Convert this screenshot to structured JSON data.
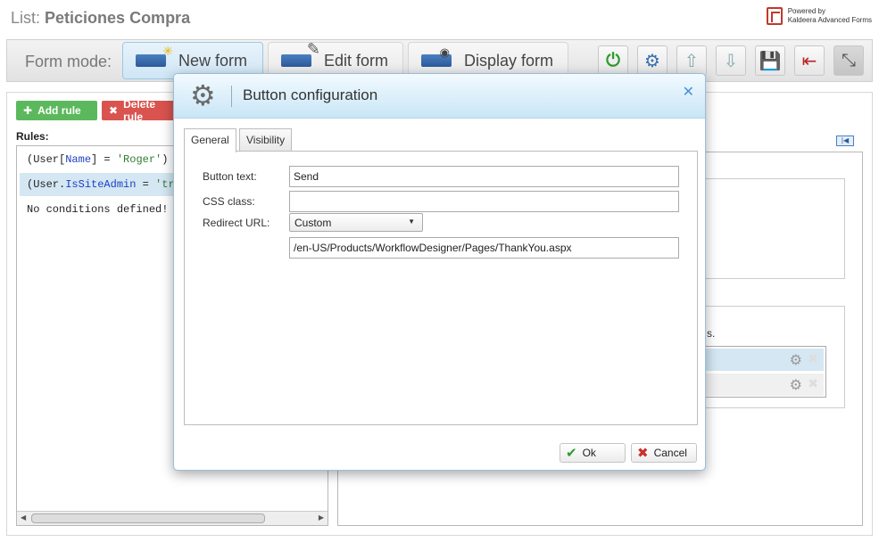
{
  "header": {
    "list_prefix": "List:",
    "list_name": "Peticiones Compra",
    "powered_line1": "Powered by",
    "powered_line2": "Kaldeera Advanced Forms"
  },
  "toolbar": {
    "form_mode_label": "Form mode:",
    "modes": [
      {
        "label": "New form",
        "active": true,
        "icon": "new-form-icon"
      },
      {
        "label": "Edit form",
        "active": false,
        "icon": "edit-form-icon"
      },
      {
        "label": "Display form",
        "active": false,
        "icon": "display-form-icon"
      }
    ],
    "tools": [
      "power-icon",
      "visibility-settings-icon",
      "export-icon",
      "import-icon",
      "save-icon",
      "exit-icon",
      "collapse-icon"
    ]
  },
  "rules_panel": {
    "add_rule_label": "Add rule",
    "delete_rule_label": "Delete rule",
    "rules_label": "Rules:",
    "rules": [
      {
        "prefix": "(User[",
        "keyword": "Name",
        "middle": "] = ",
        "value": "'Roger'",
        "suffix": ")"
      },
      {
        "prefix": "(User.",
        "keyword": "IsSiteAdmin",
        "middle": " = ",
        "value": "'true'",
        "suffix": ")"
      },
      {
        "text": "No conditions defined!"
      }
    ]
  },
  "right_panel": {
    "partial_text": "s."
  },
  "dialog": {
    "title": "Button configuration",
    "tabs": [
      "General",
      "Visibility"
    ],
    "fields": {
      "button_text_label": "Button text:",
      "button_text_value": "Send",
      "css_class_label": "CSS class:",
      "css_class_value": "",
      "redirect_url_label": "Redirect URL:",
      "redirect_option": "Custom",
      "redirect_url_value": "/en-US/Products/WorkflowDesigner/Pages/ThankYou.aspx"
    },
    "ok_label": "Ok",
    "cancel_label": "Cancel"
  },
  "colors": {
    "accent": "#4a90d9",
    "add_green": "#5cb85c",
    "delete_red": "#d9534f",
    "selection": "#d4e7f3"
  }
}
